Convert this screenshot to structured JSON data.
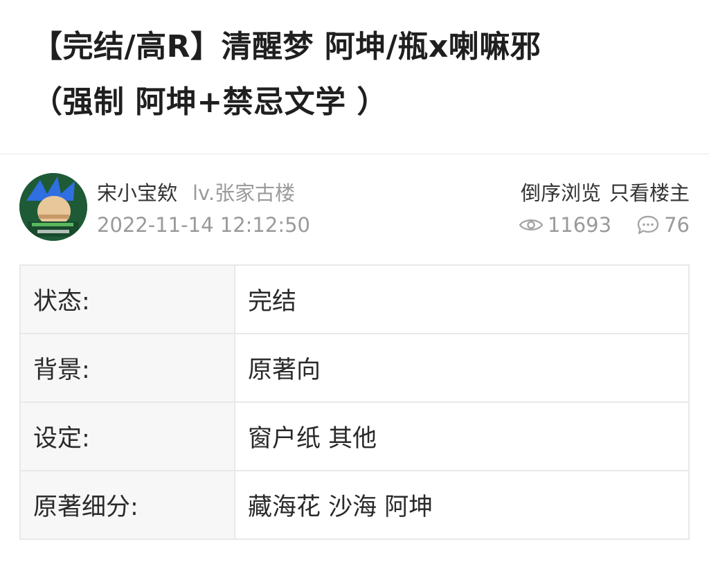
{
  "post": {
    "title_line1": "【完结/高R】清醒梦 阿坤/瓶x喇嘛邪",
    "title_line2": "（强制 阿坤+禁忌文学 ）"
  },
  "author": {
    "name": "宋小宝欸",
    "level": "lv.张家古楼",
    "time": "2022-11-14 12:12:50",
    "avatar_icon": "avatar-image"
  },
  "actions": {
    "reverse_label": "倒序浏览",
    "owner_only_label": "只看楼主"
  },
  "stats": {
    "views": "11693",
    "views_icon": "eye-icon",
    "comments": "76",
    "comments_icon": "comment-bubble-icon"
  },
  "info_table": [
    {
      "label": "状态:",
      "value": "完结"
    },
    {
      "label": "背景:",
      "value": "原著向"
    },
    {
      "label": "设定:",
      "value": "窗户纸 其他"
    },
    {
      "label": "原著细分:",
      "value": "藏海花 沙海 阿坤"
    }
  ],
  "colors": {
    "text_primary": "#222222",
    "text_secondary": "#9a9a9a",
    "border": "#e8e8e8",
    "label_bg": "#f7f7f7"
  }
}
